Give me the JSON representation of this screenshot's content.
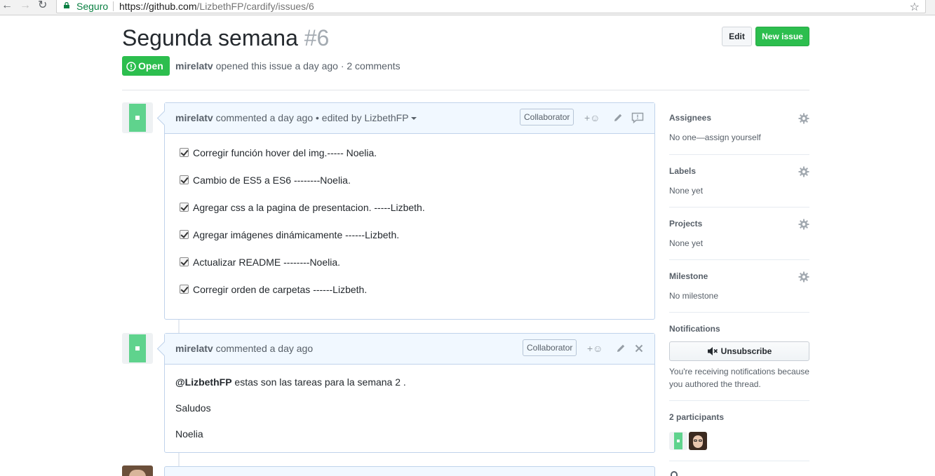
{
  "browser": {
    "secure_label": "Seguro",
    "url_host": "https://github.com",
    "url_path": "/LizbethFP/cardify/issues/6"
  },
  "issue": {
    "title": "Segunda semana",
    "number": "#6",
    "edit_label": "Edit",
    "new_issue_label": "New issue",
    "state": "Open",
    "author": "mirelatv",
    "meta_text": " opened this issue a day ago · 2 comments"
  },
  "comments": [
    {
      "author": "mirelatv",
      "header_text": " commented a day ago • edited by LizbethFP",
      "badge": "Collaborator",
      "reaction": "+☺",
      "tasks": [
        "Corregir función hover del img.----- Noelia.",
        "Cambio de ES5 a ES6 --------Noelia.",
        "Agregar css a la pagina de presentacion. -----Lizbeth.",
        "Agregar imágenes dinámicamente ------Lizbeth.",
        "Actualizar README --------Noelia.",
        "Corregir orden de carpetas ------Lizbeth."
      ]
    },
    {
      "author": "mirelatv",
      "header_text": " commented a day ago",
      "badge": "Collaborator",
      "reaction": "+☺",
      "mention": "@LizbethFP",
      "line1_rest": " estas son las tareas para la semana 2 .",
      "line2": "Saludos",
      "line3": "Noelia"
    }
  ],
  "sidebar": {
    "assignees": {
      "label": "Assignees",
      "value": "No one—assign yourself"
    },
    "labels": {
      "label": "Labels",
      "value": "None yet"
    },
    "projects": {
      "label": "Projects",
      "value": "None yet"
    },
    "milestone": {
      "label": "Milestone",
      "value": "No milestone"
    },
    "notifications": {
      "label": "Notifications",
      "button": "Unsubscribe",
      "note": "You're receiving notifications because you authored the thread."
    },
    "participants": {
      "label": "2 participants"
    }
  },
  "colors": {
    "green": "#2cbe4e",
    "comment_header": "#f1f8ff",
    "comment_border": "#c0d3eb"
  }
}
